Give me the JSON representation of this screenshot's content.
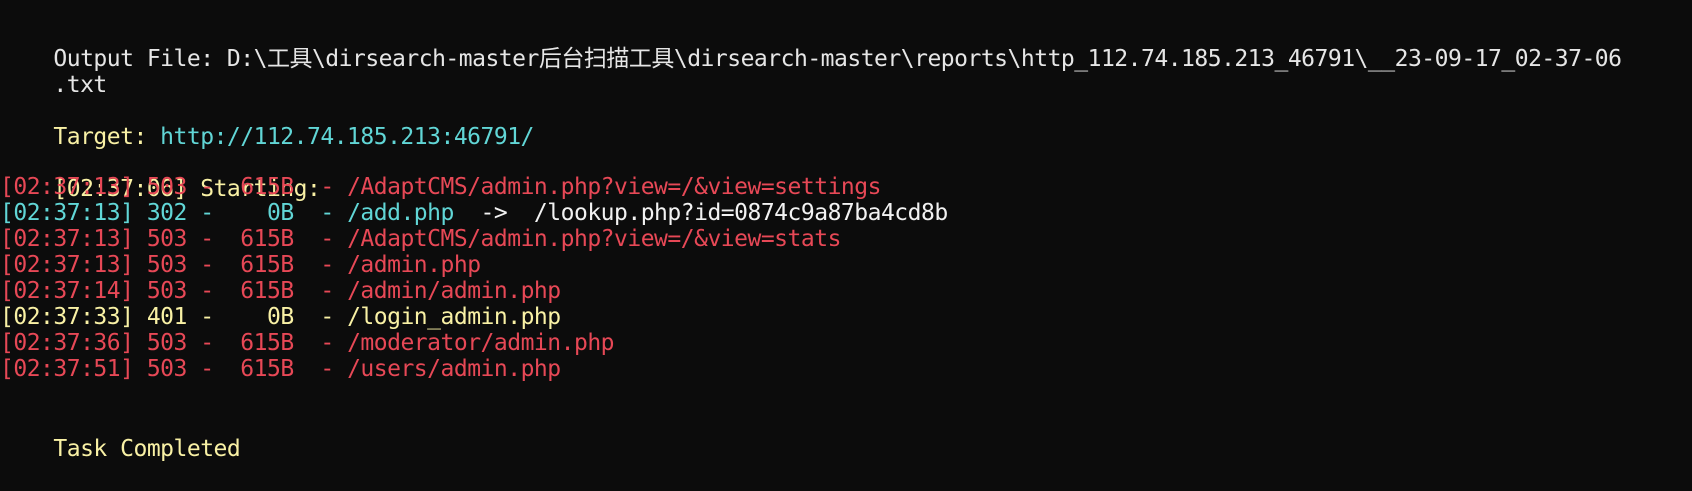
{
  "output": {
    "label": "Output File:",
    "path_line1": " D:\\工具\\dirsearch-master后台扫描工具\\dirsearch-master\\reports\\http_112.74.185.213_46791\\__23-09-17_02-37-06",
    "path_line2": ".txt"
  },
  "target": {
    "label": "Target:",
    "url": " http://112.74.185.213:46791/"
  },
  "start": {
    "time": "[02:37:06]",
    "text": " Starting:"
  },
  "results": [
    {
      "time": "[02:37:13]",
      "status": " 503 -",
      "size": "  615B",
      "sep": "  -",
      "path": " /AdaptCMS/admin.php?view=/&view=settings",
      "redirect": "",
      "color": "red"
    },
    {
      "time": "[02:37:13]",
      "status": " 302 -",
      "size": "    0B",
      "sep": "  -",
      "path": " /add.php",
      "redirect": "  ->  /lookup.php?id=0874c9a87ba4cd8b",
      "color": "cyan"
    },
    {
      "time": "[02:37:13]",
      "status": " 503 -",
      "size": "  615B",
      "sep": "  -",
      "path": " /AdaptCMS/admin.php?view=/&view=stats",
      "redirect": "",
      "color": "red"
    },
    {
      "time": "[02:37:13]",
      "status": " 503 -",
      "size": "  615B",
      "sep": "  -",
      "path": " /admin.php",
      "redirect": "",
      "color": "red"
    },
    {
      "time": "[02:37:14]",
      "status": " 503 -",
      "size": "  615B",
      "sep": "  -",
      "path": " /admin/admin.php",
      "redirect": "",
      "color": "red"
    },
    {
      "time": "[02:37:33]",
      "status": " 401 -",
      "size": "    0B",
      "sep": "  -",
      "path": " /login_admin.php",
      "redirect": "",
      "color": "yellow"
    },
    {
      "time": "[02:37:36]",
      "status": " 503 -",
      "size": "  615B",
      "sep": "  -",
      "path": " /moderator/admin.php",
      "redirect": "",
      "color": "red"
    },
    {
      "time": "[02:37:51]",
      "status": " 503 -",
      "size": "  615B",
      "sep": "  -",
      "path": " /users/admin.php",
      "redirect": "",
      "color": "red"
    }
  ],
  "footer": {
    "text": "Task Completed"
  },
  "colors": {
    "background": "#0c0c0c",
    "white": "#f2f2f2",
    "yellow": "#f9f1a5",
    "cyan": "#61d6d6",
    "red": "#e74856"
  }
}
